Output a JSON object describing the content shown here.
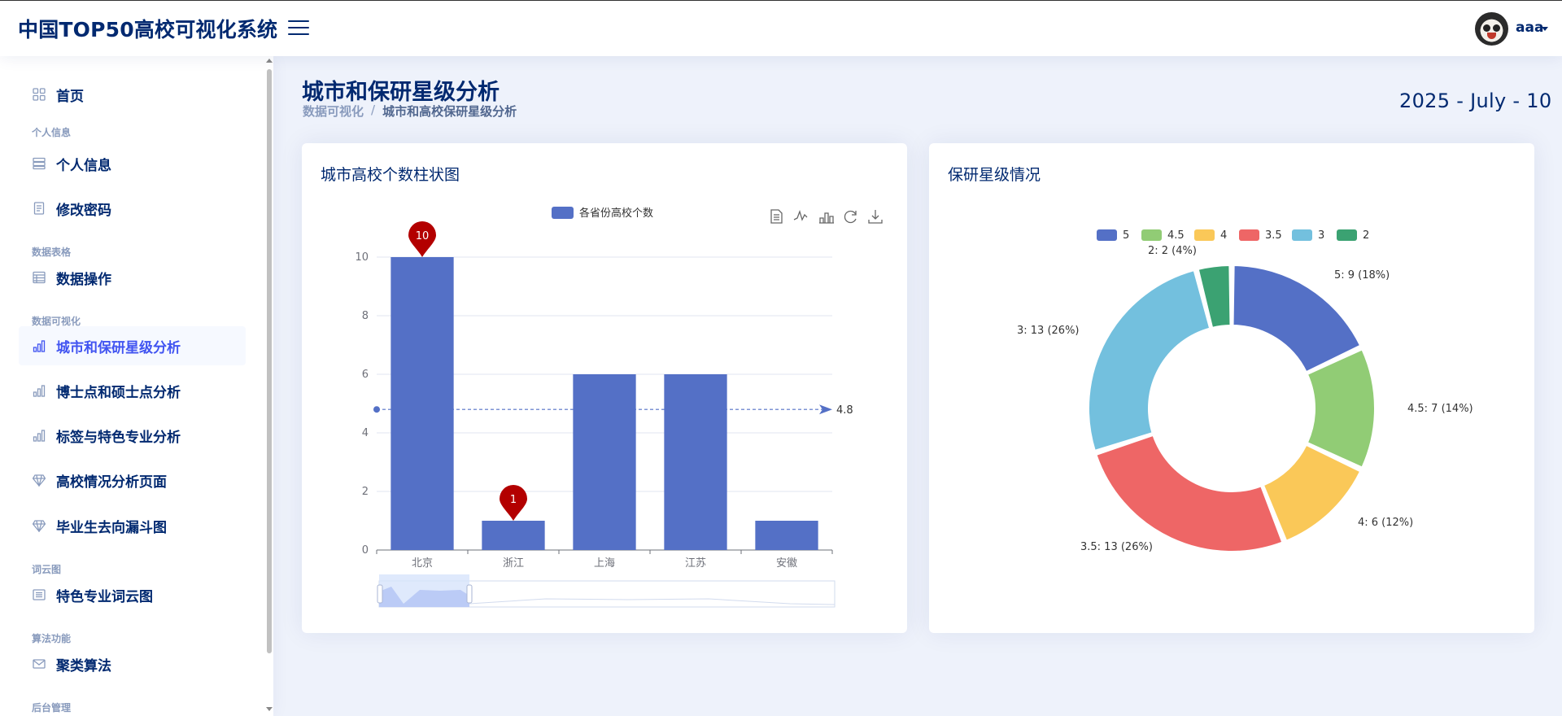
{
  "app": {
    "title": "中国TOP50高校可视化系统",
    "user_name": "aaa"
  },
  "sidebar": {
    "items": [
      {
        "type": "item",
        "label": "首页",
        "icon": "grid-icon"
      },
      {
        "type": "heading",
        "label": "个人信息"
      },
      {
        "type": "item",
        "label": "个人信息",
        "icon": "server-icon"
      },
      {
        "type": "item",
        "label": "修改密码",
        "icon": "document-icon"
      },
      {
        "type": "heading",
        "label": "数据表格"
      },
      {
        "type": "item",
        "label": "数据操作",
        "icon": "table-icon"
      },
      {
        "type": "heading",
        "label": "数据可视化"
      },
      {
        "type": "item",
        "label": "城市和保研星级分析",
        "icon": "bar-chart-icon",
        "active": true
      },
      {
        "type": "item",
        "label": "博士点和硕士点分析",
        "icon": "bar-chart-icon"
      },
      {
        "type": "item",
        "label": "标签与特色专业分析",
        "icon": "bar-chart-icon"
      },
      {
        "type": "item",
        "label": "高校情况分析页面",
        "icon": "gem-icon"
      },
      {
        "type": "item",
        "label": "毕业生去向漏斗图",
        "icon": "gem-icon"
      },
      {
        "type": "heading",
        "label": "词云图"
      },
      {
        "type": "item",
        "label": "特色专业词云图",
        "icon": "list-icon"
      },
      {
        "type": "heading",
        "label": "算法功能"
      },
      {
        "type": "item",
        "label": "聚类算法",
        "icon": "envelope-icon"
      },
      {
        "type": "heading",
        "label": "后台管理"
      }
    ]
  },
  "page": {
    "title": "城市和保研星级分析",
    "breadcrumb": [
      "数据可视化",
      "/",
      "城市和高校保研星级分析"
    ],
    "date": "2025 - July - 10"
  },
  "bar_card": {
    "title": "城市高校个数柱状图"
  },
  "pie_card": {
    "title": "保研星级情况"
  },
  "chart_data": [
    {
      "type": "bar",
      "title": "城市高校个数柱状图",
      "legend": [
        "各省份高校个数"
      ],
      "categories": [
        "北京",
        "浙江",
        "上海",
        "江苏",
        "安徽"
      ],
      "series": [
        {
          "name": "各省份高校个数",
          "values": [
            10,
            1,
            6,
            6,
            1
          ]
        }
      ],
      "ylim": [
        0,
        10
      ],
      "yticks": [
        0,
        2,
        4,
        6,
        8,
        10
      ],
      "mark_points": [
        {
          "label": "10",
          "category": "北京",
          "value": 10
        },
        {
          "label": "1",
          "category": "浙江",
          "value": 1
        }
      ],
      "mark_line": {
        "label": "4.8",
        "value": 4.8
      },
      "toolbox": [
        "data-view-icon",
        "line-icon",
        "bar-icon",
        "restore-icon",
        "download-icon"
      ],
      "color": "#5470c6",
      "markpoint_color": "#b30000",
      "legend_position": "top-center",
      "grid": true
    },
    {
      "type": "pie",
      "title": "保研星级情况",
      "legend": [
        "5",
        "4.5",
        "4",
        "3.5",
        "3",
        "2"
      ],
      "slices": [
        {
          "name": "5",
          "value": 9,
          "label": "5: 9 (18%)",
          "color": "#5470c6"
        },
        {
          "name": "4.5",
          "value": 7,
          "label": "4.5: 7 (14%)",
          "color": "#91cc75"
        },
        {
          "name": "4",
          "value": 6,
          "label": "4: 6 (12%)",
          "color": "#fac858"
        },
        {
          "name": "3.5",
          "value": 13,
          "label": "3.5: 13 (26%)",
          "color": "#ee6666"
        },
        {
          "name": "3",
          "value": 13,
          "label": "3: 13 (26%)",
          "color": "#73c0de"
        },
        {
          "name": "2",
          "value": 2,
          "label": "2: 2 (4%)",
          "color": "#3ba272"
        }
      ],
      "style": "donut",
      "legend_position": "top-center"
    }
  ]
}
